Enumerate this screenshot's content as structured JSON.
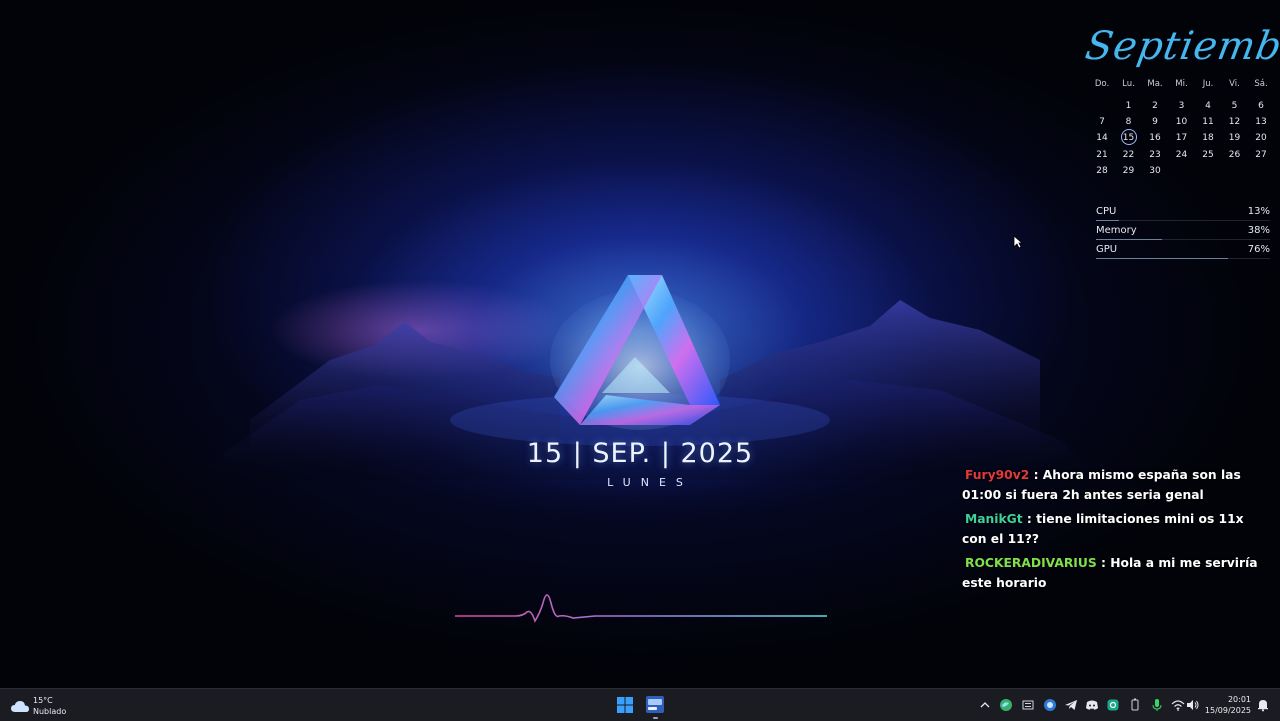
{
  "wallpaper": {
    "date_text": "15 | SEP. | 2025",
    "weekday_text": "LUNES"
  },
  "calendar": {
    "month": "Septiembre",
    "weekdays": [
      "Do.",
      "Lu.",
      "Ma.",
      "Mi.",
      "Ju.",
      "Vi.",
      "Sá."
    ],
    "weeks": [
      [
        "",
        "1",
        "2",
        "3",
        "4",
        "5",
        "6"
      ],
      [
        "7",
        "8",
        "9",
        "10",
        "11",
        "12",
        "13"
      ],
      [
        "14",
        "15",
        "16",
        "17",
        "18",
        "19",
        "20"
      ],
      [
        "21",
        "22",
        "23",
        "24",
        "25",
        "26",
        "27"
      ],
      [
        "28",
        "29",
        "30",
        "",
        "",
        "",
        ""
      ]
    ],
    "today": "15"
  },
  "system_monitor": [
    {
      "label": "CPU",
      "value": "13%",
      "level": 0.13
    },
    {
      "label": "Memory",
      "value": "38%",
      "level": 0.38
    },
    {
      "label": "GPU",
      "value": "76%",
      "level": 0.76
    }
  ],
  "chat": [
    {
      "user": "Fury90v2",
      "color": "#e23a3a",
      "text": ": Ahora mismo españa son las 01:00 si fuera 2h antes seria genal"
    },
    {
      "user": "ManikGt",
      "color": "#3fd19a",
      "text": ": tiene limitaciones mini os 11x con el 11??"
    },
    {
      "user": "ROCKERADIVARIUS",
      "color": "#7fe04a",
      "text": ": Hola a mi me serviría este horario"
    }
  ],
  "taskbar": {
    "weather_temp": "15°C",
    "weather_desc": "Nublado",
    "time": "20:01",
    "date": "15/09/2025",
    "weather_icon": "cloud-icon",
    "start_icon": "windows-logo-icon"
  },
  "colors": {
    "accent_blue": "#46b6ee",
    "wave_start": "#d94a9c",
    "wave_end": "#5fe0e6"
  }
}
